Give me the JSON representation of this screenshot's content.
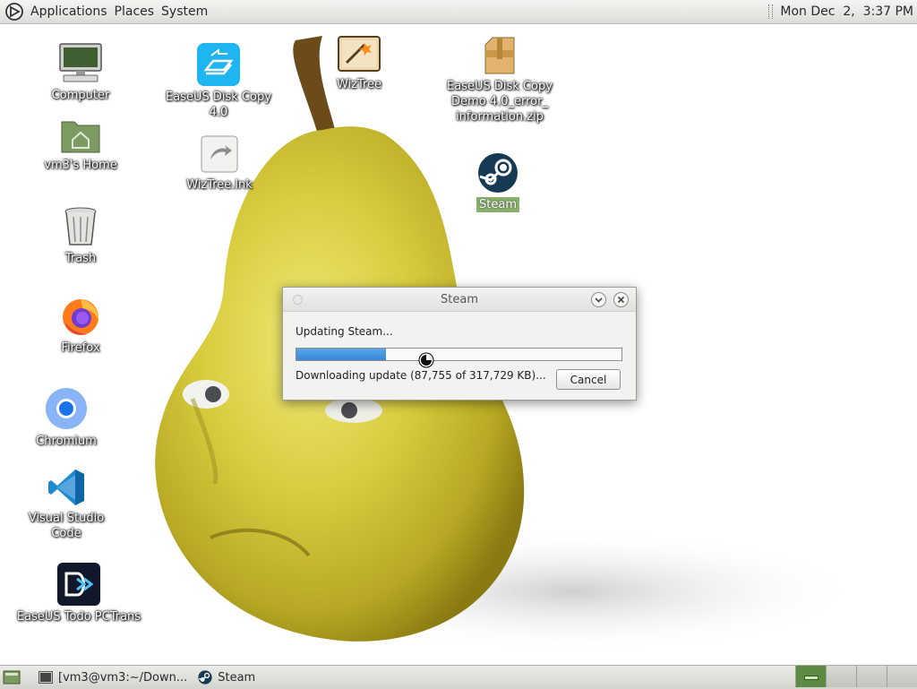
{
  "top_panel": {
    "menus": [
      "Applications",
      "Places",
      "System"
    ],
    "clock": "Mon Dec  2,  3:37 PM"
  },
  "desktop_icons": [
    {
      "label": "Computer",
      "icon": "computer-icon"
    },
    {
      "label": "vm3's Home",
      "icon": "home-folder-icon"
    },
    {
      "label": "Trash",
      "icon": "trash-icon"
    },
    {
      "label": "Firefox",
      "icon": "firefox-icon"
    },
    {
      "label": "Chromium",
      "icon": "chromium-icon"
    },
    {
      "label": "Visual Studio Code",
      "icon": "vscode-icon"
    },
    {
      "label": "EaseUS Todo PCTrans",
      "icon": "easeus-pctrans-icon"
    },
    {
      "label": "EaseUS Disk Copy 4.0",
      "icon": "easeus-disk-copy-icon"
    },
    {
      "label": "WizTree.lnk",
      "icon": "shortcut-icon"
    },
    {
      "label": "WizTree",
      "icon": "wiztree-icon"
    },
    {
      "label": "EaseUS Disk Copy\nDemo 4.0_error_\ninformation.zip",
      "icon": "zip-archive-icon"
    },
    {
      "label": "Steam",
      "icon": "steam-icon",
      "selected": true
    }
  ],
  "dialog": {
    "title": "Steam",
    "status": "Updating Steam...",
    "progress_percent": 27.6,
    "detail": "Downloading update (87,755 of 317,729 KB)...",
    "cancel_label": "Cancel",
    "accent": "#3a86d8"
  },
  "taskbar": {
    "tasks": [
      {
        "label": "[vm3@vm3:~/Down...",
        "icon": "terminal-icon"
      },
      {
        "label": "Steam",
        "icon": "steam-icon"
      }
    ],
    "workspaces": 4,
    "active_workspace": 1
  }
}
